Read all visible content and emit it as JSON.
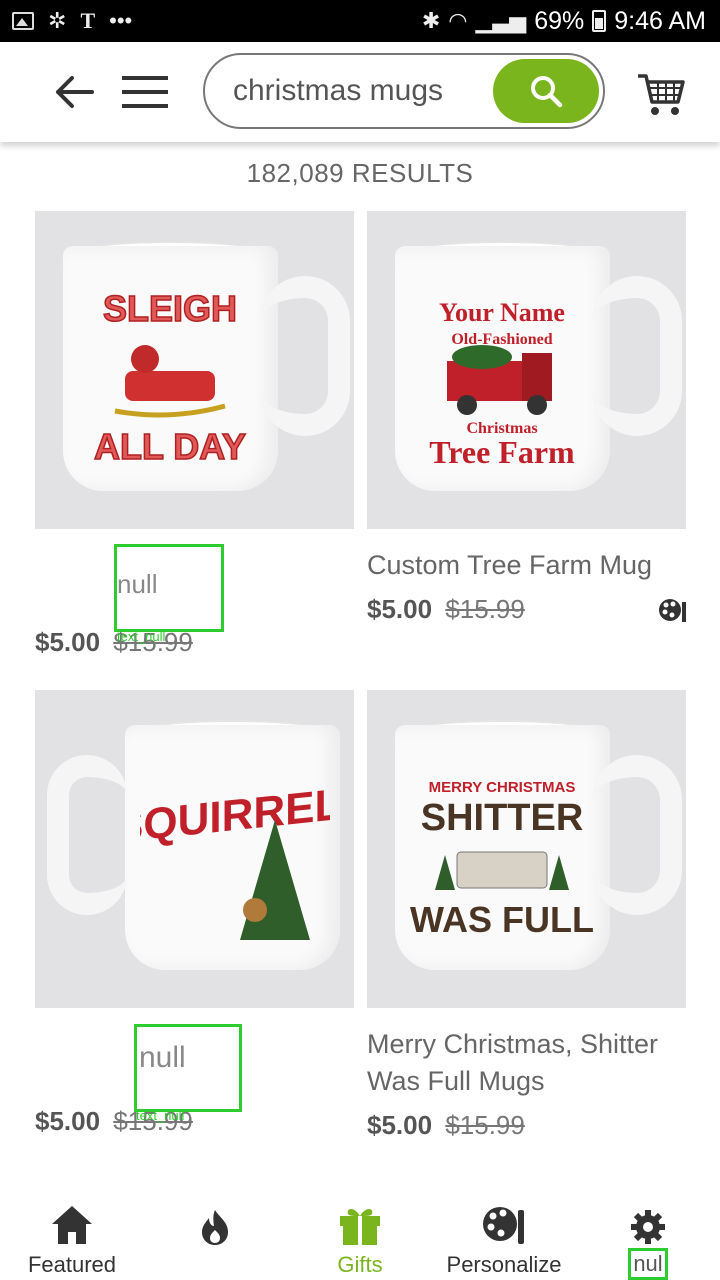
{
  "status_bar": {
    "battery": "69%",
    "time": "9:46 AM"
  },
  "header": {
    "search": {
      "value": "christmas mugs",
      "placeholder": ""
    }
  },
  "results_label": "182,089 RESULTS",
  "products": [
    {
      "title": "",
      "price": "$5.00",
      "original_price": "$15.99",
      "null_label": "null",
      "null_tag": "text_null"
    },
    {
      "title": "Custom Tree Farm Mug",
      "price": "$5.00",
      "original_price": "$15.99"
    },
    {
      "title": "",
      "price": "$5.00",
      "original_price": "$15.99",
      "null_label": "null",
      "null_tag": "text_null"
    },
    {
      "title": "Merry Christmas, Shitter Was Full Mugs",
      "price": "$5.00",
      "original_price": "$15.99"
    }
  ],
  "mug_art": {
    "sleigh_top": "SLEIGH",
    "sleigh_bottom": "ALL DAY",
    "tree_line1": "Your Name",
    "tree_line2": "Old-Fashioned",
    "tree_line3": "Christmas",
    "tree_line4": "Tree Farm",
    "squirrel": "SQUIRREL!",
    "rv_line1": "MERRY CHRISTMAS",
    "rv_line2": "SHITTER",
    "rv_line3": "WAS FULL"
  },
  "bottom_nav": [
    {
      "label": "Featured",
      "icon": "home-icon"
    },
    {
      "label": "",
      "icon": "flame-icon"
    },
    {
      "label": "Gifts",
      "icon": "gift-icon",
      "active": true
    },
    {
      "label": "Personalize",
      "icon": "palette-icon"
    },
    {
      "label": "nul",
      "icon": "gear-icon"
    }
  ],
  "colors": {
    "accent": "#7ab51d",
    "annotation": "#2ecc2e",
    "mug_red": "#c0202a"
  }
}
